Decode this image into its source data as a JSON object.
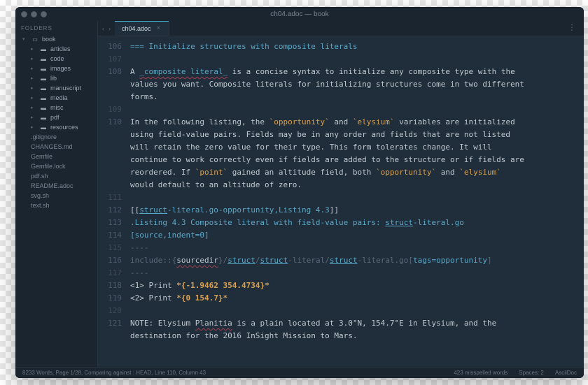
{
  "window": {
    "title": "ch04.adoc — book"
  },
  "sidebar": {
    "header": "FOLDERS",
    "root": "book",
    "folders": [
      "articles",
      "code",
      "images",
      "lib",
      "manuscript",
      "media",
      "misc",
      "pdf",
      "resources"
    ],
    "files": [
      ".gitignore",
      "CHANGES.md",
      "Gemfile",
      "Gemfile.lock",
      "pdf.sh",
      "README.adoc",
      "svg.sh",
      "text.sh"
    ]
  },
  "tabs": [
    {
      "label": "ch04.adoc"
    }
  ],
  "editor": {
    "first_line": 106,
    "rows": [
      {
        "n": 106,
        "hl": true,
        "seg": [
          {
            "t": "=== ",
            "c": "k-head"
          },
          {
            "t": "Initialize structures with composite literals",
            "c": "k-head"
          }
        ]
      },
      {
        "n": 107,
        "seg": []
      },
      {
        "n": 108,
        "hl": true,
        "seg": [
          {
            "t": "A "
          },
          {
            "t": "_composite literal_",
            "c": "k-em"
          },
          {
            "t": " is a concise syntax to initialize any composite type with the"
          }
        ]
      },
      {
        "n": null,
        "seg": [
          {
            "t": "values you want. Composite literals for initializing structures come in two different"
          }
        ]
      },
      {
        "n": null,
        "seg": [
          {
            "t": "forms."
          }
        ]
      },
      {
        "n": 109,
        "seg": []
      },
      {
        "n": 110,
        "hl": true,
        "seg": [
          {
            "t": "In the following listing, the "
          },
          {
            "t": "`opportunity`",
            "c": "k-code"
          },
          {
            "t": " and "
          },
          {
            "t": "`elysium`",
            "c": "k-code"
          },
          {
            "t": " variables are initialized"
          }
        ]
      },
      {
        "n": null,
        "seg": [
          {
            "t": "using field-value pairs. Fields may be in any order and fields that are not listed"
          }
        ]
      },
      {
        "n": null,
        "seg": [
          {
            "t": "will retain the zero value for their type. This form tolerates change. It will"
          }
        ]
      },
      {
        "n": null,
        "seg": [
          {
            "t": "continue to work correctly even if fields are added to the structure or if fields are"
          }
        ]
      },
      {
        "n": null,
        "seg": [
          {
            "t": "reordered. If "
          },
          {
            "t": "`point`",
            "c": "k-code"
          },
          {
            "t": " gained an altitude field, both "
          },
          {
            "t": "`opportunity`",
            "c": "k-code"
          },
          {
            "t": " and "
          },
          {
            "t": "`elysium`",
            "c": "k-code"
          }
        ]
      },
      {
        "n": null,
        "seg": [
          {
            "t": "would default to an altitude of zero."
          }
        ]
      },
      {
        "n": 111,
        "seg": []
      },
      {
        "n": 112,
        "hl": true,
        "seg": [
          {
            "t": "[["
          },
          {
            "t": "struct",
            "c": "k-ul"
          },
          {
            "t": "-literal.go-opportunity,Listing 4.3",
            "c": "k-anchor"
          },
          {
            "t": "]]"
          }
        ]
      },
      {
        "n": 113,
        "hl": true,
        "seg": [
          {
            "t": ".Listing 4.3 Composite literal with field-value pairs: ",
            "c": "k-anchor"
          },
          {
            "t": "struct",
            "c": "k-ul"
          },
          {
            "t": "-literal.go",
            "c": "k-anchor"
          }
        ]
      },
      {
        "n": 114,
        "hl": true,
        "seg": [
          {
            "t": "[source,indent=0]",
            "c": "k-anchor"
          }
        ]
      },
      {
        "n": 115,
        "seg": [
          {
            "t": "----",
            "c": "k-dim"
          }
        ]
      },
      {
        "n": 116,
        "hl": true,
        "seg": [
          {
            "t": "include::{",
            "c": "k-dim"
          },
          {
            "t": "sourcedir",
            "c": "k-wavy"
          },
          {
            "t": "}/",
            "c": "k-dim"
          },
          {
            "t": "struct",
            "c": "k-ul"
          },
          {
            "t": "/",
            "c": "k-dim"
          },
          {
            "t": "struct",
            "c": "k-ul"
          },
          {
            "t": "-literal/",
            "c": "k-dim"
          },
          {
            "t": "struct",
            "c": "k-ul"
          },
          {
            "t": "-literal.go[",
            "c": "k-dim"
          },
          {
            "t": "tags=opportunity",
            "c": "k-attr"
          },
          {
            "t": "]",
            "c": "k-dim"
          }
        ]
      },
      {
        "n": 117,
        "seg": [
          {
            "t": "----",
            "c": "k-dim"
          }
        ]
      },
      {
        "n": 118,
        "hl": true,
        "seg": [
          {
            "t": "<1> Print "
          },
          {
            "t": "*{-1.9462 354.4734}*",
            "c": "k-bold"
          }
        ]
      },
      {
        "n": 119,
        "hl": true,
        "seg": [
          {
            "t": "<2> Print "
          },
          {
            "t": "*{0 154.7}*",
            "c": "k-bold"
          }
        ]
      },
      {
        "n": 120,
        "seg": []
      },
      {
        "n": 121,
        "hl": true,
        "seg": [
          {
            "t": "NOTE: Elysium "
          },
          {
            "t": "Planitia",
            "c": "k-wavy"
          },
          {
            "t": " is a plain located at 3.0°N, 154.7°E in Elysium, and the"
          }
        ]
      },
      {
        "n": null,
        "seg": [
          {
            "t": "destination for the 2016 InSight Mission to Mars."
          }
        ]
      }
    ]
  },
  "status": {
    "left": "8233 Words, Page 1/28, Comparing against : HEAD, Line 110, Column 43",
    "misspelled": "423 misspelled words",
    "spaces": "Spaces: 2",
    "syntax": "AsciiDoc"
  }
}
